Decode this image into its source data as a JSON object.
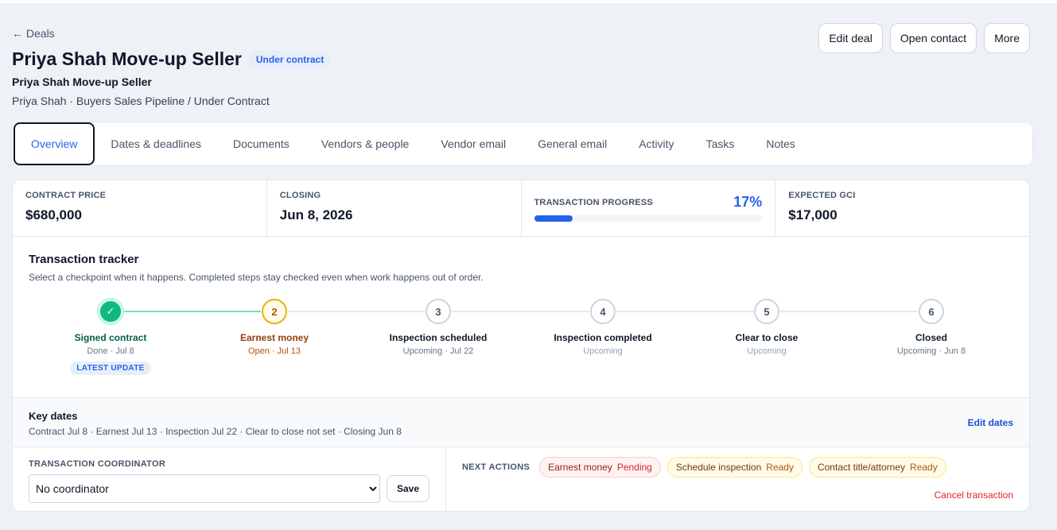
{
  "header": {
    "back_label": "← Deals",
    "title": "Priya Shah Move-up Seller",
    "status": "Under contract",
    "subtitle": "Priya Shah Move-up Seller",
    "meta": "Priya Shah · Buyers Sales Pipeline / Under Contract",
    "actions": [
      "Edit deal",
      "Open contact",
      "More"
    ]
  },
  "tabs": [
    "Overview",
    "Dates & deadlines",
    "Documents",
    "Vendors & people",
    "Vendor email",
    "General email",
    "Activity",
    "Tasks",
    "Notes"
  ],
  "active_tab": "Overview",
  "stats": {
    "contract_price_label": "CONTRACT PRICE",
    "contract_price": "$680,000",
    "closing_label": "CLOSING",
    "closing": "Jun 8, 2026",
    "progress_label": "TRANSACTION PROGRESS",
    "progress_pct": "17%",
    "progress_value": 0.17,
    "gci_label": "EXPECTED GCI",
    "gci": "$17,000"
  },
  "tracker": {
    "title": "Transaction tracker",
    "description": "Select a checkpoint when it happens. Completed steps stay checked even when work happens out of order.",
    "latest_badge": "LATEST UPDATE",
    "steps": [
      {
        "marker": "✓",
        "name": "Signed contract",
        "sub": "Done · Jul 8",
        "state": "done"
      },
      {
        "marker": "2",
        "name": "Earnest money",
        "sub": "Open · Jul 13",
        "state": "open"
      },
      {
        "marker": "3",
        "name": "Inspection scheduled",
        "sub": "Upcoming · Jul 22",
        "state": "upcoming"
      },
      {
        "marker": "4",
        "name": "Inspection completed",
        "sub": "Upcoming",
        "state": "upcoming-muted"
      },
      {
        "marker": "5",
        "name": "Clear to close",
        "sub": "Upcoming",
        "state": "upcoming-muted"
      },
      {
        "marker": "6",
        "name": "Closed",
        "sub": "Upcoming · Jun 8",
        "state": "upcoming"
      }
    ]
  },
  "key_dates": {
    "title": "Key dates",
    "text": "Contract Jul 8 · Earnest Jul 13 · Inspection Jul 22 · Clear to close not set · Closing Jun 8",
    "edit_label": "Edit dates"
  },
  "coordinator": {
    "label": "TRANSACTION COORDINATOR",
    "selected": "No coordinator",
    "save_label": "Save"
  },
  "next_actions": {
    "label": "NEXT ACTIONS",
    "items": [
      {
        "name": "Earnest money",
        "status": "Pending",
        "kind": "pending"
      },
      {
        "name": "Schedule inspection",
        "status": "Ready",
        "kind": "ready"
      },
      {
        "name": "Contact title/attorney",
        "status": "Ready",
        "kind": "ready"
      }
    ],
    "cancel_label": "Cancel transaction"
  },
  "colors": {
    "accent": "#2563eb",
    "done": "#10b981",
    "open": "#eab308",
    "danger": "#dc2626"
  }
}
